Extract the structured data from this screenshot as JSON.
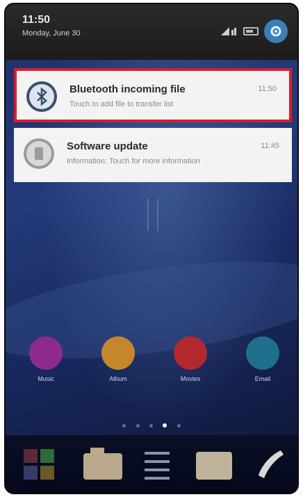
{
  "status_bar": {
    "time": "11:50",
    "date": "Monday, June 30"
  },
  "notifications": [
    {
      "title": "Bluetooth incoming file",
      "subtitle": "Touch to add file to transfer list",
      "time": "11:50",
      "icon": "bluetooth-icon",
      "highlighted": true
    },
    {
      "title": "Software update",
      "subtitle": "Information: Touch for more information",
      "time": "11:45",
      "icon": "update-icon",
      "highlighted": false
    }
  ],
  "home_apps": [
    {
      "label": "Music",
      "color": "#8e2a8f",
      "icon": "music-icon"
    },
    {
      "label": "Album",
      "color": "#c6872c",
      "icon": "album-icon"
    },
    {
      "label": "Movies",
      "color": "#b3272f",
      "icon": "movies-icon"
    },
    {
      "label": "Email",
      "color": "#1f6e8c",
      "icon": "email-icon"
    }
  ],
  "page_indicator": {
    "count": 5,
    "active": 3
  },
  "colors": {
    "highlight_border": "#d91c2b",
    "statusbar": "#222222",
    "settings_button": "#3c7fb8"
  }
}
